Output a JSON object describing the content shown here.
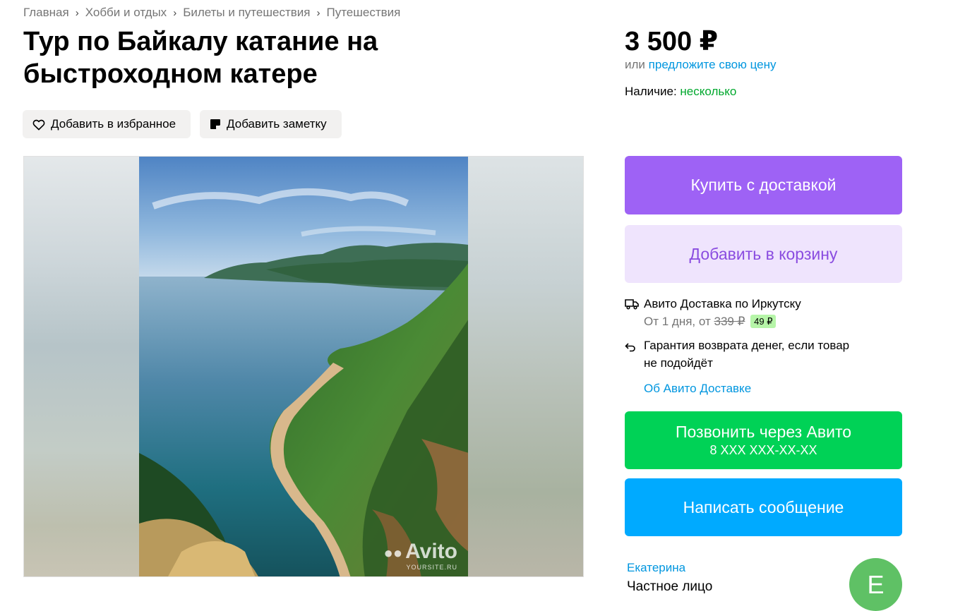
{
  "breadcrumbs": [
    "Главная",
    "Хобби и отдых",
    "Билеты и путешествия",
    "Путешествия"
  ],
  "title": "Тур по Байкалу катание на быстроходном катере",
  "actions": {
    "favorite_label": "Добавить в избранное",
    "note_label": "Добавить заметку"
  },
  "gallery": {
    "watermark": "Avito",
    "watermark_sub": "YOURSITE.RU"
  },
  "pricing": {
    "price": "3 500 ₽",
    "offer_prefix": "или",
    "offer_link": "предложите свою цену",
    "availability_label": "Наличие:",
    "availability_value": "несколько"
  },
  "buttons": {
    "buy": "Купить с доставкой",
    "cart": "Добавить в корзину",
    "call": "Позвонить через Авито",
    "call_phone": "8 XXX XXX-XX-XX",
    "message": "Написать сообщение"
  },
  "delivery": {
    "title": "Авито Доставка по Иркутску",
    "days": "От 1 дня, от",
    "old_price": "339 ₽",
    "new_price": "49 ₽",
    "guarantee": "Гарантия возврата денег, если товар не подойдёт",
    "about_link": "Об Авито Доставке"
  },
  "seller": {
    "name": "Екатерина",
    "type": "Частное лицо",
    "avatar_letter": "Е",
    "avatar_color": "#5fc165"
  },
  "colors": {
    "buy": "#9e62f5",
    "cart": "#efe4fd",
    "call": "#00d256",
    "message": "#00aaff",
    "link": "#0096df",
    "availability": "#00a82d"
  },
  "icons": {
    "favorite": "heart-icon",
    "note": "note-icon",
    "delivery": "truck-icon",
    "guarantee": "return-arrow-icon"
  }
}
